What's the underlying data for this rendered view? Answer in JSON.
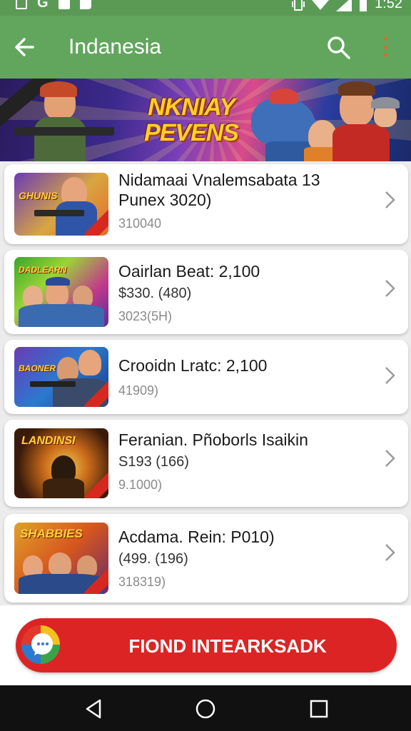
{
  "status_bar": {
    "time": "1:52",
    "icons": [
      "notification-box-icon",
      "google-icon",
      "notification-fill-icon",
      "messenger-icon",
      "vibrate-icon",
      "wifi-icon",
      "signal-icon",
      "battery-icon"
    ]
  },
  "app_bar": {
    "title": "Indanesia",
    "back_icon": "arrow-left-icon",
    "search_icon": "search-icon",
    "more_icon": "more-vert-icon",
    "color": "#62a65d"
  },
  "banner": {
    "title_line1": "NKNIAY",
    "title_line2": "PEVENS"
  },
  "items": [
    {
      "thumb_text": "GHUNIS",
      "title_line1": "Nidamaai Vnalemsabata 13",
      "title_line2": "Punex 3020)",
      "meta": "310040"
    },
    {
      "thumb_text": "DADLEARN",
      "title_line1": "Oairlan Beat: 2,100",
      "title_line2": "$330. (480)",
      "meta": "3023(5H)"
    },
    {
      "thumb_text": "BAONER",
      "title_line1": "Crooidn Lratc: 2,100",
      "title_line2": "",
      "meta": "41909)"
    },
    {
      "thumb_text": "LANDINSI",
      "title_line1": "Feranian. Pñoborls Isaikin",
      "title_line2": "S193 (166)",
      "meta": "9.1000)"
    },
    {
      "thumb_text": "SHABBIES",
      "title_line1": "Acdama. Rein: P010)",
      "title_line2": "(499. (196)",
      "meta": "318319)"
    }
  ],
  "cta": {
    "label": "FIOND INTEARKSADK",
    "color": "#dc2424"
  },
  "nav": {
    "back_icon": "nav-back-icon",
    "home_icon": "nav-home-icon",
    "recents_icon": "nav-recents-icon"
  }
}
